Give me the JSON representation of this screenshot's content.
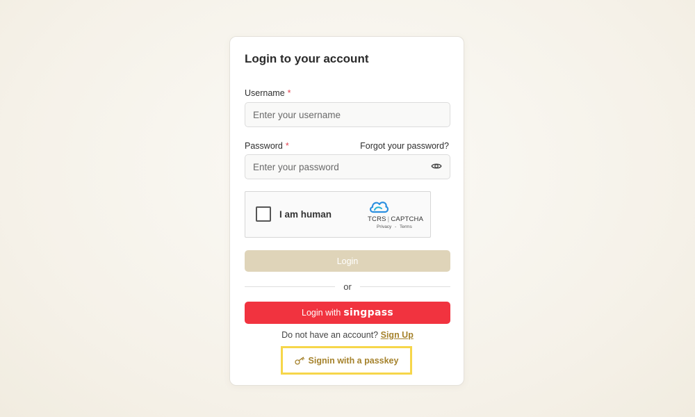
{
  "login": {
    "title": "Login to your account",
    "username": {
      "label": "Username",
      "required_mark": "*",
      "placeholder": "Enter your username",
      "value": ""
    },
    "password": {
      "label": "Password",
      "required_mark": "*",
      "placeholder": "Enter your password",
      "value": "",
      "forgot_link": "Forgot your password?",
      "toggle_icon": "eye-icon"
    },
    "captcha": {
      "checkbox_label": "I am human",
      "brand_left": "TCRS",
      "brand_separator": "|",
      "brand_right": "CAPTCHA",
      "privacy": "Privacy",
      "dash": "-",
      "terms": "Terms",
      "logo_icon": "cloud-icon"
    },
    "login_button": "Login",
    "divider_text": "or",
    "singpass_button": {
      "prefix": "Login with",
      "logo_text": "singpass"
    },
    "signup": {
      "prompt": "Do not have an account?",
      "link": "Sign Up"
    },
    "passkey_button": {
      "label": "Signin with a passkey",
      "icon": "key-icon"
    }
  },
  "colors": {
    "accent_gold": "#a5822c",
    "login_button_disabled": "#dfd4b9",
    "singpass_red": "#f1333f",
    "required_red": "#e2424f",
    "highlight_yellow": "#f6d64a"
  }
}
